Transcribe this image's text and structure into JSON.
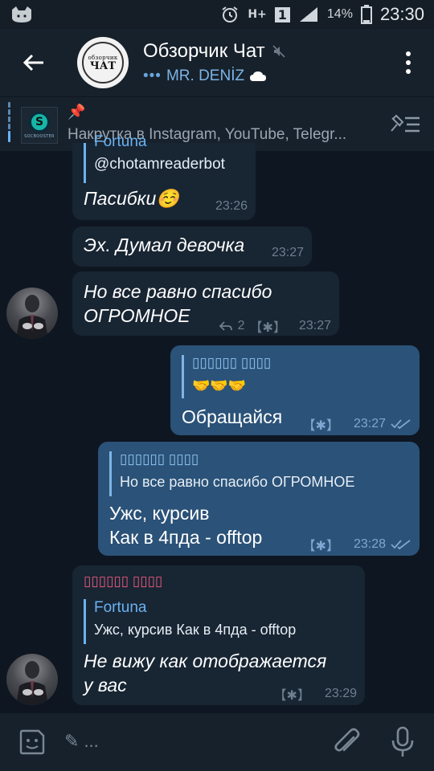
{
  "status_bar": {
    "network": "H+",
    "sim": "1",
    "battery": "14%",
    "time": "23:30"
  },
  "header": {
    "avatar_line1": "обзорчик",
    "avatar_line2": "ЧАТ",
    "title": "Обзорчик Чат",
    "typing_dots": "•••",
    "typing_user": "MR. DENİZ"
  },
  "pinned": {
    "thumb_letter": "S",
    "thumb_label": "SOCBOOSTER",
    "text": "Накрутка в Instagram, YouTube, Telegr..."
  },
  "messages": [
    {
      "cut_name": "Fortuna",
      "reply_text": "@chotamreaderbot",
      "text": "Пасибки☺️",
      "time": "23:26"
    },
    {
      "text": "Эх. Думал девочка",
      "time": "23:27"
    },
    {
      "text_l1": "Но все равно спасибо",
      "text_l2": "ОГРОМНОЕ",
      "reply_count": "2",
      "tag": "【✱】",
      "time": "23:27"
    },
    {
      "reply_name": "▯▯▯▯▯▯ ▯▯▯▯",
      "reply_text": "🤝🤝🤝",
      "text": "Обращайся",
      "tag": "【✱】",
      "time": "23:27"
    },
    {
      "reply_name": "▯▯▯▯▯▯ ▯▯▯▯",
      "reply_text": "Но все равно спасибо ОГРОМНОЕ",
      "text_l1": "Ужс, курсив",
      "text_l2": "Как в 4пда - offtop",
      "tag": "【✱】",
      "time": "23:28"
    },
    {
      "sender": "▯▯▯▯▯▯ ▯▯▯▯",
      "reply_name": "Fortuna",
      "reply_text": "Ужс, курсив Как в 4пда - offtop",
      "text_l1": "Не вижу как отображается",
      "text_l2": "у вас",
      "tag": "【✱】",
      "time": "23:29"
    }
  ],
  "composer": {
    "pencil": "✎",
    "placeholder": "..."
  },
  "colors": {
    "background": "#0e1621",
    "header": "#17212b",
    "incoming": "#182533",
    "outgoing": "#2b5278",
    "accent": "#6ab2f2",
    "sender_name": "#e5597d"
  }
}
